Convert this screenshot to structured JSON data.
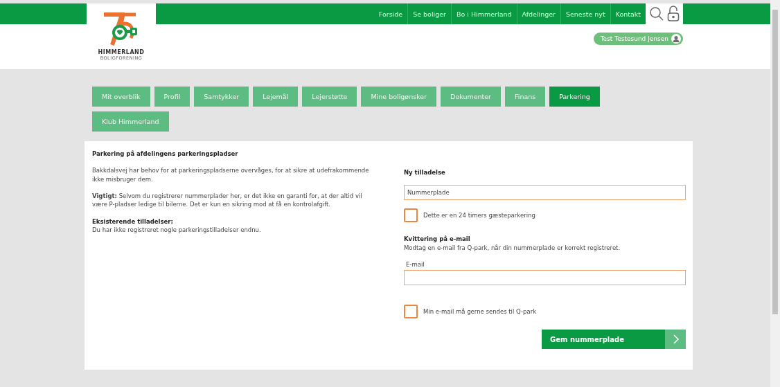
{
  "logo": {
    "title": "HIMMERLAND",
    "subtitle": "BOLIGFORENING"
  },
  "nav": [
    "Forside",
    "Se boliger",
    "Bo i Himmerland",
    "Afdelinger",
    "Seneste nyt",
    "Kontakt"
  ],
  "user": {
    "name": "Test Testesund Jensen"
  },
  "tabs": [
    {
      "label": "Mit overblik",
      "selected": false
    },
    {
      "label": "Profil",
      "selected": false
    },
    {
      "label": "Samtykker",
      "selected": false
    },
    {
      "label": "Lejemål",
      "selected": false
    },
    {
      "label": "Lejerstøtte",
      "selected": false
    },
    {
      "label": "Mine boligønsker",
      "selected": false
    },
    {
      "label": "Dokumenter",
      "selected": false
    },
    {
      "label": "Finans",
      "selected": false
    },
    {
      "label": "Parkering",
      "selected": true
    },
    {
      "label": "Klub Himmerland",
      "selected": false
    }
  ],
  "info": {
    "title": "Parkering på afdelingens parkeringspladser",
    "paragraphs": [
      "Bakkdalsvej har behov for at parkeringspladserne overvåges, for at sikre at udefrakommende ikke misbruger dem.",
      "**Vigtigt:** Selvom du registrerer nummerplader her, er det ikke en garanti for, at der altid vil være P-pladser ledige til bilerne. Det er kun en sikring mod at få en kontrolafgift."
    ],
    "existing_title": "Eksisterende tilladelser:",
    "existing_text": "Du har ikke registreret nogle parkeringstilladelser endnu."
  },
  "form": {
    "title": "Ny tilladelse",
    "plate": {
      "placeholder": "Nummerplade"
    },
    "guest": {
      "label": "Dette er en 24 timers gæsteparkering",
      "checked": false
    },
    "receipt_title": "Kvittering på e-mail",
    "receipt_text": "Modtag en e-mail fra Q-park, når din nummerplade er korrekt registreret.",
    "email": {
      "label": "E-mail"
    },
    "consent": {
      "label": "Min e-mail må gerne sendes til Q-park",
      "checked": false
    },
    "submit": "Gem nummerplade"
  }
}
